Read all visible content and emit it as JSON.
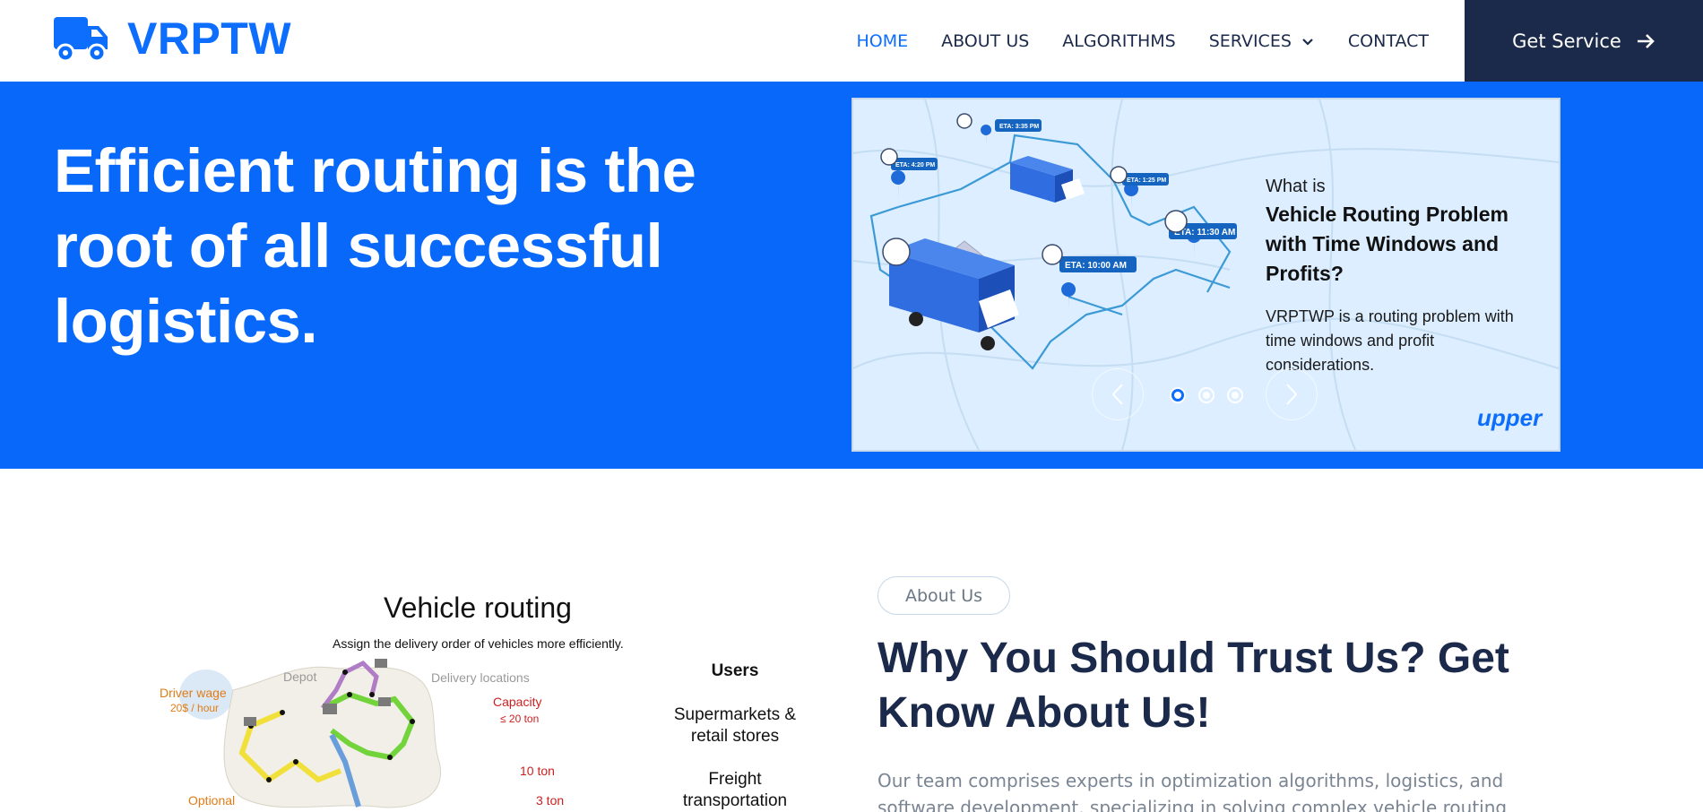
{
  "brand": {
    "name": "VRPTW",
    "icon": "truck-icon",
    "color": "#0d6efd"
  },
  "nav": {
    "items": [
      {
        "label": "HOME",
        "active": true
      },
      {
        "label": "ABOUT US",
        "active": false
      },
      {
        "label": "ALGORITHMS",
        "active": false
      },
      {
        "label": "SERVICES",
        "active": false,
        "has_dropdown": true
      },
      {
        "label": "CONTACT",
        "active": false
      }
    ],
    "cta": "Get Service",
    "cta_icon": "arrow-right-icon"
  },
  "hero": {
    "title": "Efficient routing is the root of all successful logistics.",
    "background": "#0868fa",
    "slide": {
      "question": "What is",
      "heading": "Vehicle Routing Problem with Time Windows and Profits?",
      "description": "VRPTWP is a routing problem with time windows and profit considerations.",
      "brand": "upper",
      "eta_labels": [
        "ETA: 3:35 PM",
        "ETA: 4:20 PM",
        "ETA: 1:25 PM",
        "ETA: 11:30 AM",
        "ETA: 10:00 AM"
      ],
      "dots": 3,
      "active_dot": 1
    }
  },
  "figure": {
    "title": "Vehicle routing",
    "subtitle": "Assign the delivery order of vehicles more efficiently.",
    "labels": {
      "depot": "Depot",
      "delivery": "Delivery locations",
      "driver_wage": "Driver wage",
      "wage_value": "20$ / hour",
      "capacity": "Capacity",
      "capacity_value": "≤ 20 ton",
      "ton10": "10 ton",
      "ton3": "3 ton",
      "optional": "Optional"
    },
    "users_title": "Users",
    "user1": "Supermarkets & retail stores",
    "user2": "Freight transportation"
  },
  "about": {
    "pill": "About Us",
    "title": "Why You Should Trust Us? Get Know About Us!",
    "text": "Our team comprises experts in optimization algorithms, logistics, and software development, specializing in solving complex vehicle routing problems. With years"
  }
}
